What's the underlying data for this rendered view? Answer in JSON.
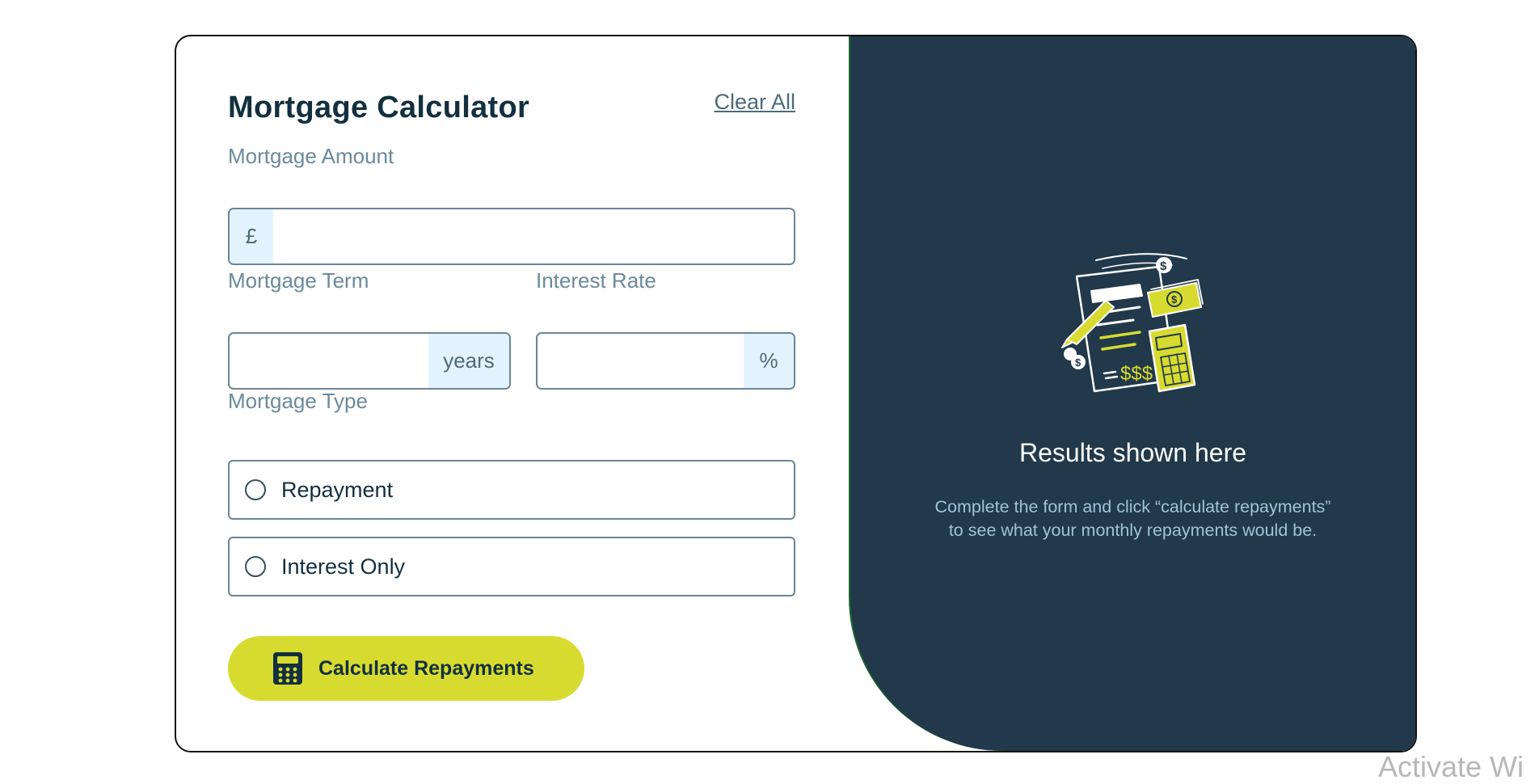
{
  "form": {
    "title": "Mortgage Calculator",
    "clear_label": "Clear All",
    "amount": {
      "label": "Mortgage Amount",
      "prefix": "£",
      "value": "",
      "placeholder": ""
    },
    "term": {
      "label": "Mortgage Term",
      "suffix": "years",
      "value": "",
      "placeholder": ""
    },
    "rate": {
      "label": "Interest Rate",
      "suffix": "%",
      "value": "",
      "placeholder": ""
    },
    "type": {
      "label": "Mortgage Type",
      "options": [
        {
          "label": "Repayment",
          "selected": false
        },
        {
          "label": "Interest Only",
          "selected": false
        }
      ]
    },
    "submit_label": "Calculate Repayments",
    "submit_icon": "calculator-icon"
  },
  "results": {
    "illustration": "calculator-documents-illustration",
    "heading": "Results shown here",
    "line1": "Complete the form and click “calculate repayments”",
    "line2": "to see what your monthly repayments would be."
  },
  "watermark": "Activate Wi",
  "colors": {
    "accent": "#d8db2f",
    "panel": "#21394a",
    "text_dark": "#12303f",
    "label": "#6b8a9a",
    "affix_bg": "#e3f3fd"
  }
}
